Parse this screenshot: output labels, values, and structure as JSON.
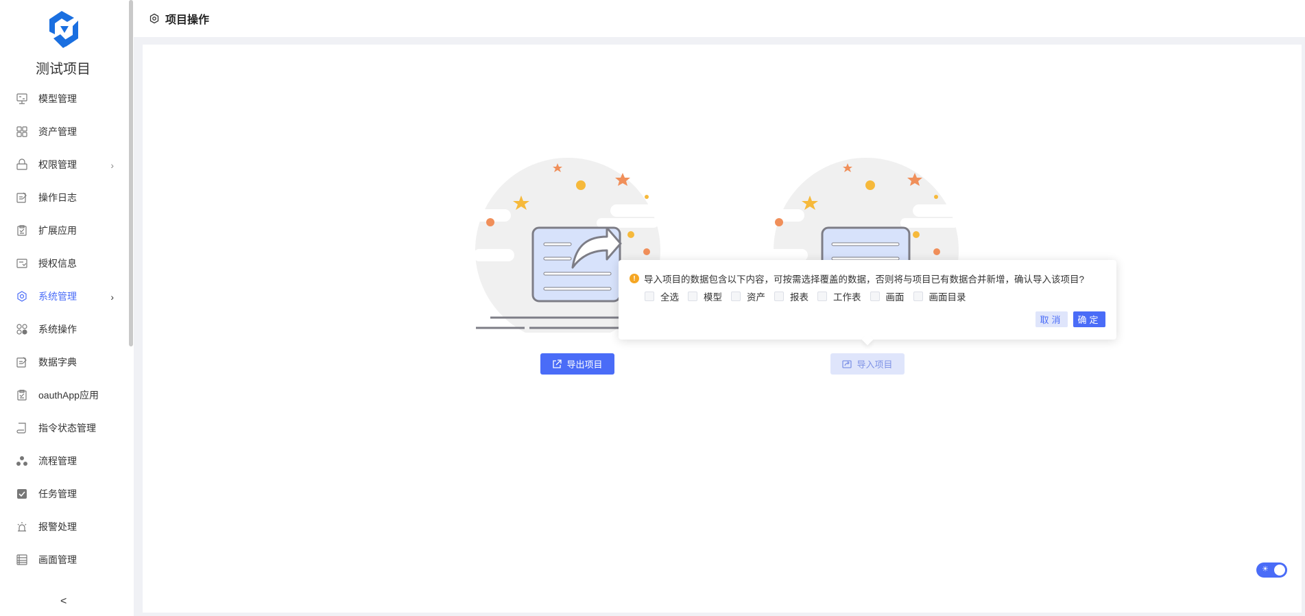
{
  "sidebar": {
    "project_name": "测试项目",
    "items": [
      {
        "label": "模型管理",
        "icon": "monitor-icon"
      },
      {
        "label": "资产管理",
        "icon": "grid-icon"
      },
      {
        "label": "权限管理",
        "icon": "lock-icon"
      },
      {
        "label": "操作日志",
        "icon": "edit-icon"
      },
      {
        "label": "扩展应用",
        "icon": "clipboard-icon"
      },
      {
        "label": "授权信息",
        "icon": "auth-icon"
      },
      {
        "label": "系统管理",
        "icon": "settings-icon"
      },
      {
        "label": "系统操作",
        "icon": "apps-icon"
      },
      {
        "label": "数据字典",
        "icon": "edit-icon"
      },
      {
        "label": "oauthApp应用",
        "icon": "clipboard-icon"
      },
      {
        "label": "指令状态管理",
        "icon": "scroll-icon"
      },
      {
        "label": "流程管理",
        "icon": "flow-icon"
      },
      {
        "label": "任务管理",
        "icon": "task-icon"
      },
      {
        "label": "报警处理",
        "icon": "alarm-icon"
      },
      {
        "label": "画面管理",
        "icon": "calendar-icon"
      }
    ],
    "collapse_glyph": "<"
  },
  "header": {
    "title": "项目操作",
    "icon": "gear-icon"
  },
  "main": {
    "export_button": "导出项目",
    "import_button": "导入项目"
  },
  "popover": {
    "message": "导入项目的数据包含以下内容，可按需选择覆盖的数据，否则将与项目已有数据合并新增，确认导入该项目?",
    "options": [
      "全选",
      "模型",
      "资产",
      "报表",
      "工作表",
      "画面",
      "画面目录"
    ],
    "cancel_label": "取消",
    "ok_label": "确定"
  },
  "colors": {
    "accent": "#4a6cf7",
    "accent_light": "#dfe5fb",
    "warning": "#f5a623"
  }
}
